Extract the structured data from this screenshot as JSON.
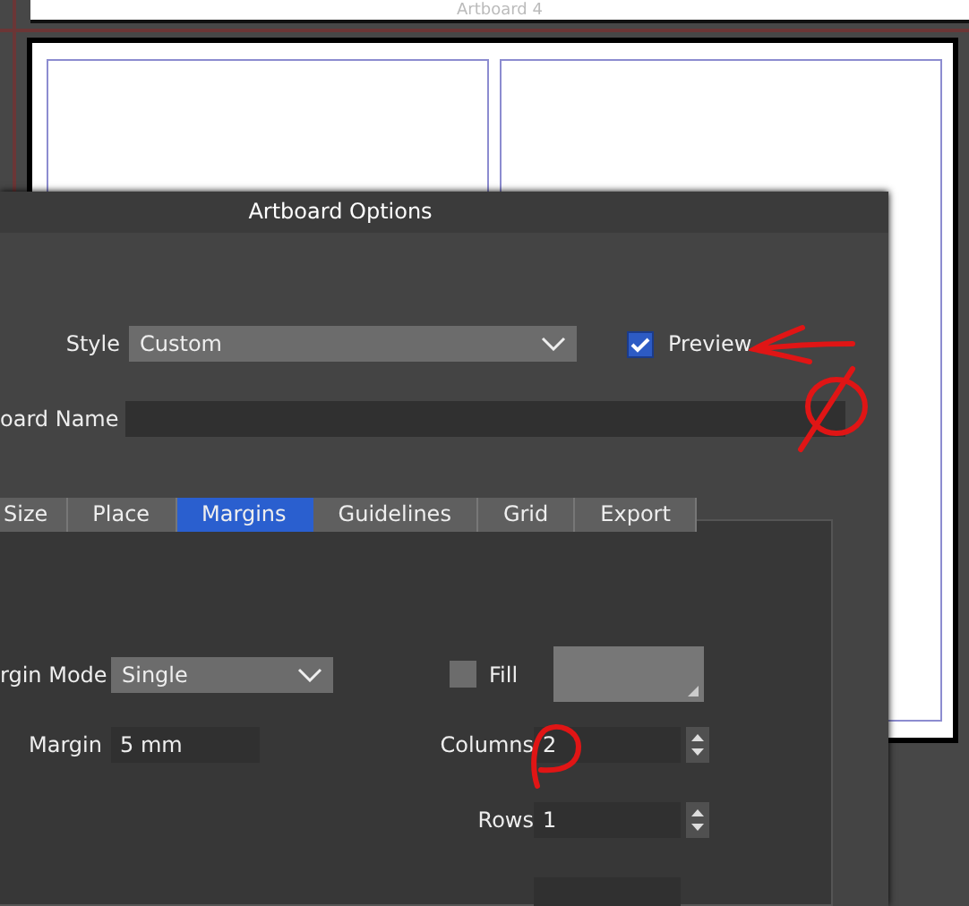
{
  "canvas": {
    "artboard_label": "Artboard 4"
  },
  "dialog": {
    "title": "Artboard Options",
    "style": {
      "label": "Style",
      "value": "Custom"
    },
    "preview": {
      "label": "Preview",
      "checked": true
    },
    "name": {
      "label": "oard Name"
    },
    "tabs": [
      {
        "label": "Size",
        "selected": false
      },
      {
        "label": "Place",
        "selected": false
      },
      {
        "label": "Margins",
        "selected": true
      },
      {
        "label": "Guidelines",
        "selected": false
      },
      {
        "label": "Grid",
        "selected": false
      },
      {
        "label": "Export",
        "selected": false
      }
    ],
    "margin_mode": {
      "label": "rgin Mode",
      "value": "Single"
    },
    "fill": {
      "label": "Fill",
      "checked": false
    },
    "margin": {
      "label": "Margin",
      "value": "5 mm"
    },
    "columns": {
      "label": "Columns",
      "value": "2"
    },
    "rows": {
      "label": "Rows",
      "value": "1"
    }
  }
}
